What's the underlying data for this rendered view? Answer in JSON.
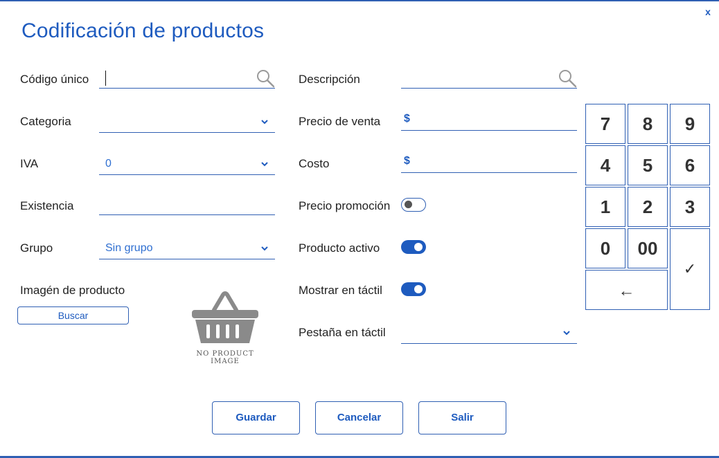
{
  "window": {
    "title": "Codificación de productos",
    "close_label": "x"
  },
  "form": {
    "codigo_label": "Código único",
    "codigo_value": "",
    "descripcion_label": "Descripción",
    "descripcion_value": "",
    "categoria_label": "Categoria",
    "categoria_value": "",
    "precio_venta_label": "Precio de venta",
    "precio_venta_currency": "$",
    "iva_label": "IVA",
    "iva_value": "0",
    "costo_label": "Costo",
    "costo_currency": "$",
    "existencia_label": "Existencia",
    "precio_promocion_label": "Precio promoción",
    "precio_promocion_on": false,
    "grupo_label": "Grupo",
    "grupo_value": "Sin grupo",
    "producto_activo_label": "Producto activo",
    "producto_activo_on": true,
    "imagen_label": "Imagén de producto",
    "buscar_label": "Buscar",
    "no_image_text": "NO PRODUCT IMAGE",
    "mostrar_tactil_label": "Mostrar en táctil",
    "mostrar_tactil_on": true,
    "pestana_label": "Pestaña en táctil",
    "pestana_value": ""
  },
  "keypad": {
    "k7": "7",
    "k8": "8",
    "k9": "9",
    "k4": "4",
    "k5": "5",
    "k6": "6",
    "k1": "1",
    "k2": "2",
    "k3": "3",
    "k0": "0",
    "k00": "00",
    "backspace": "←",
    "enter": "✓"
  },
  "actions": {
    "guardar": "Guardar",
    "cancelar": "Cancelar",
    "salir": "Salir"
  },
  "colors": {
    "accent": "#1e5bbf",
    "border": "#2f5fb3",
    "text": "#222222"
  },
  "icons": [
    "search-icon",
    "chevron-down-icon",
    "basket-icon"
  ]
}
